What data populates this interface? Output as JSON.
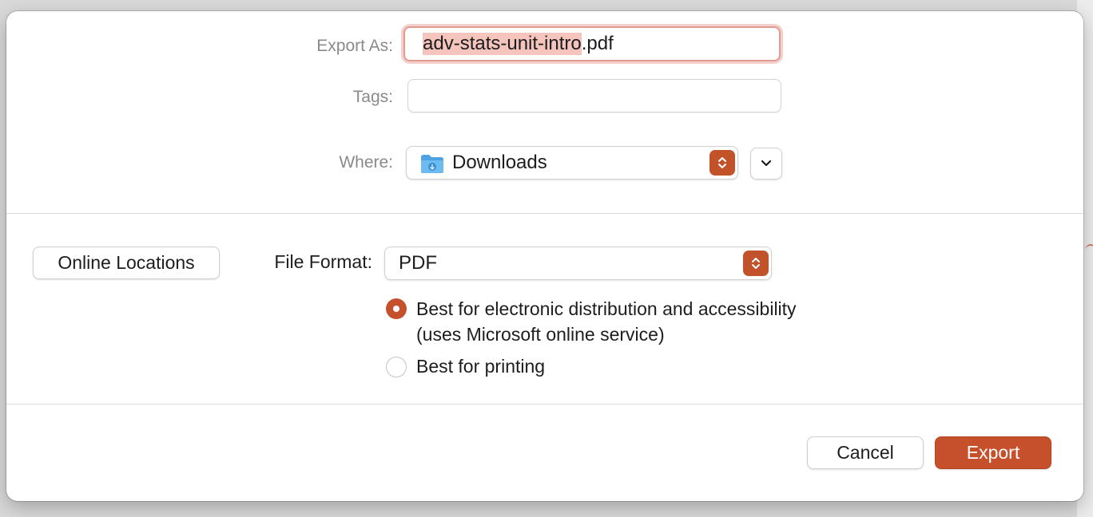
{
  "export_as": {
    "label": "Export As:",
    "filename_base": "adv-stats-unit-intro",
    "filename_ext": ".pdf"
  },
  "tags": {
    "label": "Tags:",
    "value": ""
  },
  "where": {
    "label": "Where:",
    "value": "Downloads",
    "icon": "folder-icon"
  },
  "online_locations": {
    "label": "Online Locations"
  },
  "file_format": {
    "label": "File Format:",
    "value": "PDF"
  },
  "options": [
    {
      "line1": "Best for electronic distribution and accessibility",
      "line2": "(uses Microsoft online service)",
      "selected": true
    },
    {
      "line1": "Best for printing",
      "line2": "",
      "selected": false
    }
  ],
  "buttons": {
    "cancel": "Cancel",
    "export": "Export"
  },
  "colors": {
    "accent": "#c6502b",
    "selection": "#f5c4bc"
  }
}
